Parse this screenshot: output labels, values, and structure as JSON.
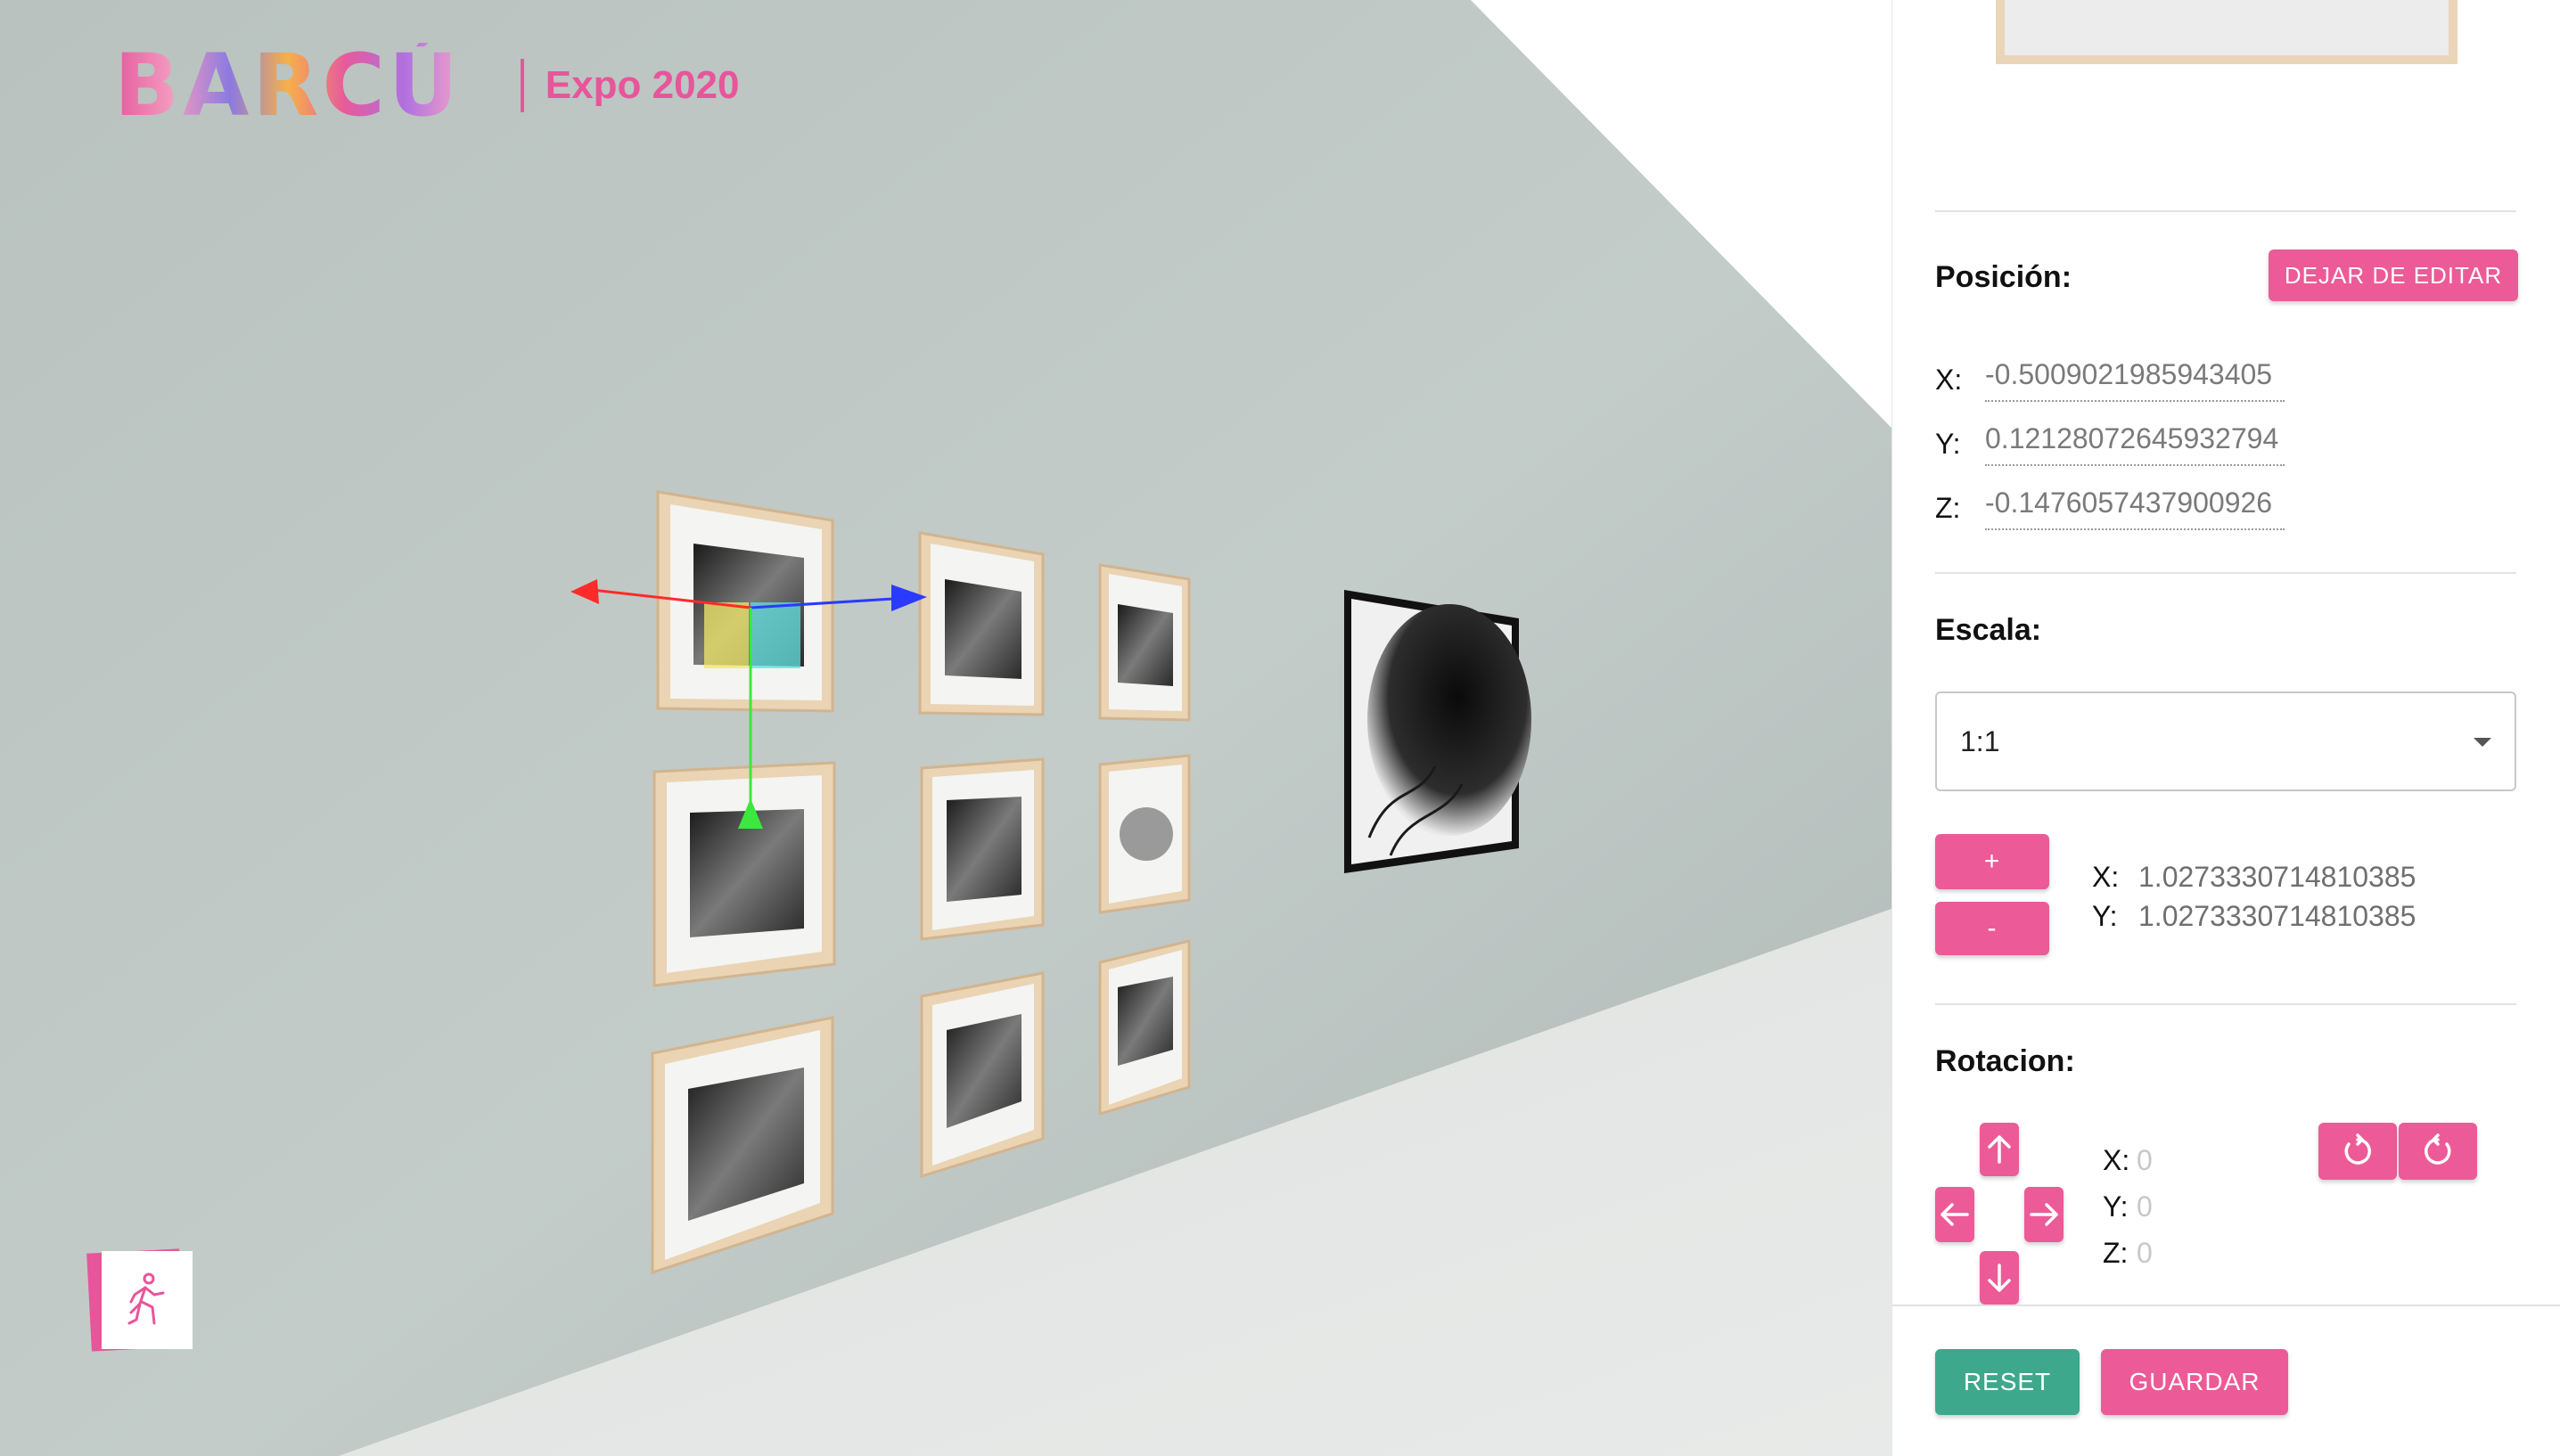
{
  "brand": {
    "logo_text": "BARCÚ",
    "subtitle": "Expo 2020",
    "accent_color": "#e8559a"
  },
  "viewport": {
    "walk_icon": "walking-person-icon"
  },
  "panel": {
    "position": {
      "title": "Posición:",
      "stop_edit_label": "DEJAR DE EDITAR",
      "x_label": "X:",
      "x_value": "-0.5009021985943405",
      "y_label": "Y:",
      "y_value": "0.12128072645932794",
      "z_label": "Z:",
      "z_value": "-0.1476057437900926"
    },
    "scale": {
      "title": "Escala:",
      "selected": "1:1",
      "plus_label": "+",
      "minus_label": "-",
      "x_label": "X:",
      "x_value": "1.0273330714810385",
      "y_label": "Y:",
      "y_value": "1.0273330714810385"
    },
    "rotation": {
      "title": "Rotacion:",
      "x_label": "X:",
      "x_value": "0",
      "y_label": "Y:",
      "y_value": "0",
      "z_label": "Z:",
      "z_value": "0",
      "icons": [
        "arrow-up-icon",
        "arrow-left-icon",
        "arrow-right-icon",
        "arrow-down-icon",
        "rotate-ccw-icon",
        "rotate-cw-icon"
      ]
    },
    "footer": {
      "reset_label": "RESET",
      "save_label": "GUARDAR",
      "reset_color": "#3ea88c",
      "save_color": "#ec5b97"
    }
  }
}
